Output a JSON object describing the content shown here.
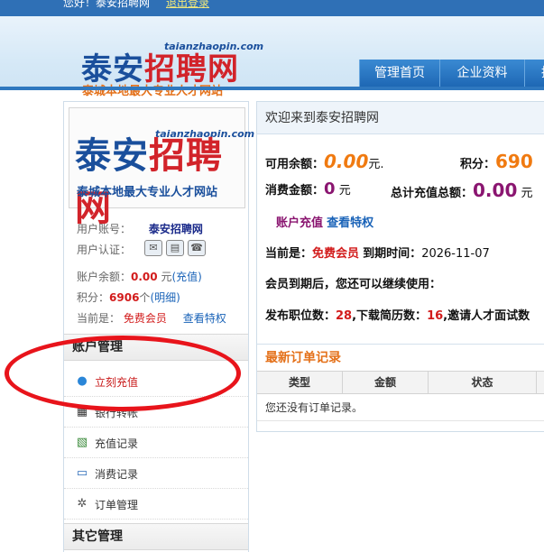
{
  "topbar": {
    "welcome": "您好！泰安招聘网",
    "logout": "退出登录"
  },
  "logo": {
    "name_blue": "泰安",
    "name_red": "招聘网",
    "url": "taianzhaopin.com",
    "slogan": "泰城本地最大专业人才网站"
  },
  "nav": {
    "tabs": [
      "管理首页",
      "企业资料",
      "招"
    ]
  },
  "sidebar": {
    "logo": {
      "name_blue": "泰安",
      "name_red": "招聘网",
      "url": "taianzhaopin.com",
      "slogan": "泰城本地最大专业人才网站"
    },
    "account_label": "用户账号：",
    "account_value": "泰安招聘网",
    "cert_label": "用户认证：",
    "balance_label": "账户余额：",
    "balance_value": "0.00",
    "balance_unit": "元",
    "balance_link": "(充值)",
    "points_label": "积分：",
    "points_value": "6906",
    "points_unit": "个",
    "points_link": "(明细)",
    "level_label": "当前是：",
    "level_value": "免费会员",
    "level_link": "查看特权",
    "section_account": "账户管理",
    "menu": [
      {
        "label": "立刻充值",
        "icon": "chat-bubble-icon"
      },
      {
        "label": "银行转帐",
        "icon": "bank-icon"
      },
      {
        "label": "充值记录",
        "icon": "chart-icon"
      },
      {
        "label": "消费记录",
        "icon": "monitor-icon"
      },
      {
        "label": "订单管理",
        "icon": "gear-icon"
      }
    ],
    "section_other": "其它管理"
  },
  "main": {
    "title": "欢迎来到泰安招聘网",
    "available_label": "可用余额：",
    "available_value": "0.00",
    "available_unit": "元.",
    "points_label": "积分：",
    "points_value": "690",
    "consume_label": "消费金额：",
    "consume_value": "0",
    "consume_unit": "元",
    "total_label": "总计充值总额：",
    "total_value": "0.00",
    "total_unit": "元",
    "recharge_link": "账户充值",
    "privilege_link": "查看特权",
    "member_prefix": "当前是：",
    "member_value": "免费会员",
    "expire_label": "到期时间：",
    "expire_value": "2026-11-07",
    "expire_note": "会员到期后，您还可以继续使用：",
    "quota_1_label": "发布职位数：",
    "quota_1_value": "28",
    "quota_2_label": ",下载简历数：",
    "quota_2_value": "16",
    "quota_3_label": ",邀请人才面试数",
    "orders_title": "最新订单记录",
    "orders_columns": [
      "类型",
      "金额",
      "状态"
    ],
    "orders_empty": "您还没有订单记录。"
  }
}
